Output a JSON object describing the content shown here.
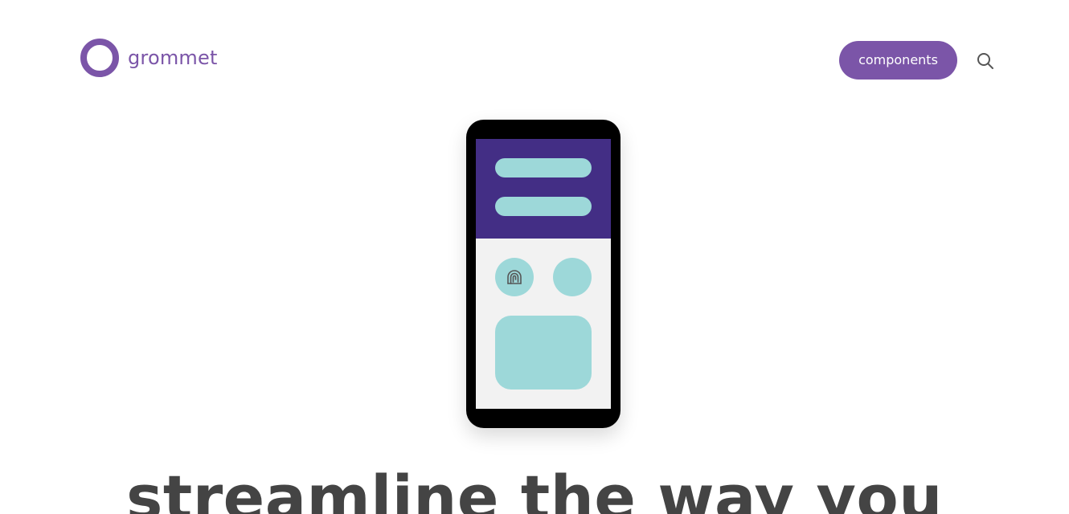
{
  "header": {
    "brand_name": "grommet",
    "components_label": "components",
    "search_icon": "search-icon"
  },
  "hero": {
    "illustration_icon": "fingerprint-icon",
    "headline": "streamline the way you"
  },
  "colors": {
    "brand": "#7b55a8",
    "header": "#432e85",
    "accent": "#9dd8d9",
    "screen_bg": "#f2f2f2",
    "text": "#444444"
  }
}
